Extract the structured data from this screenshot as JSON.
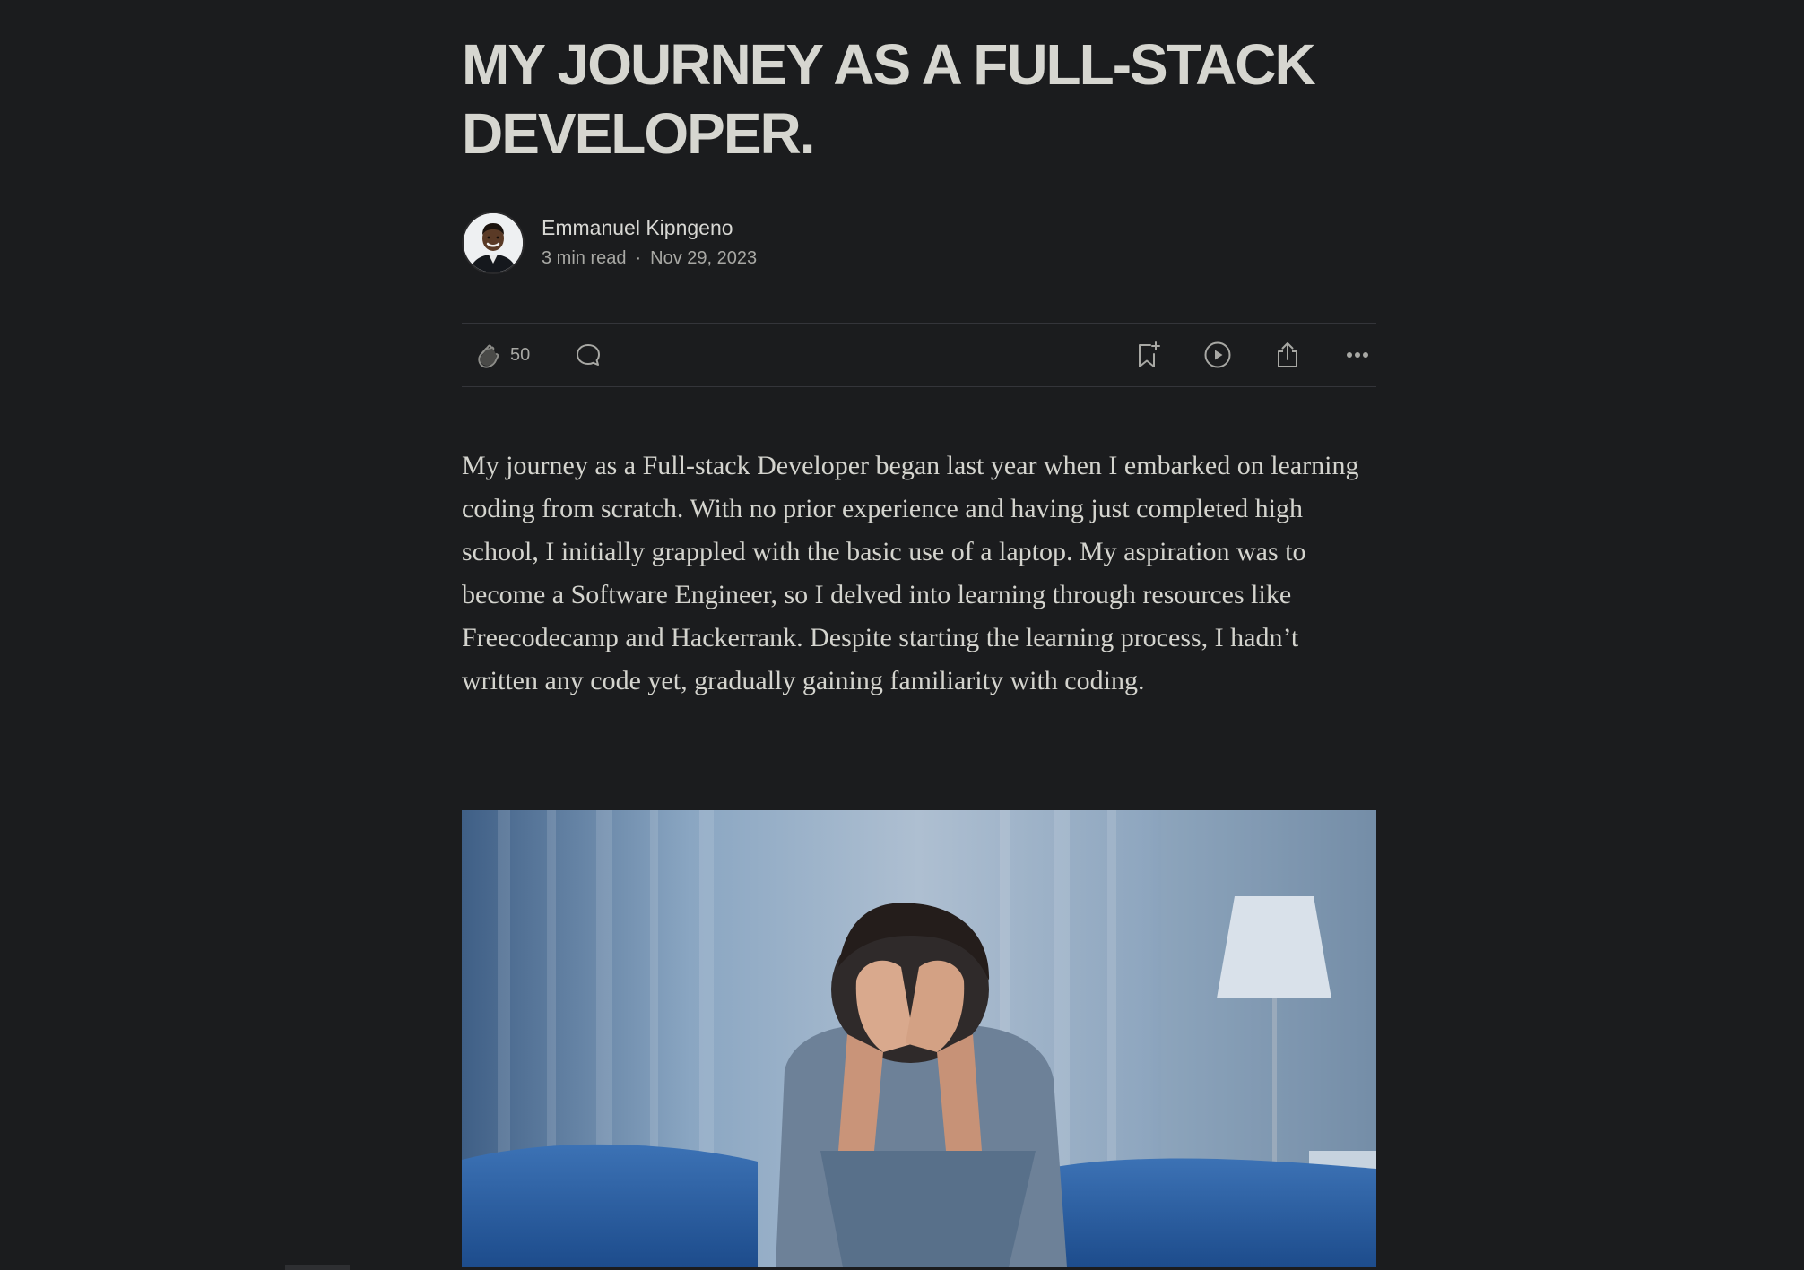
{
  "article": {
    "title": "MY JOURNEY AS A FULL-STACK DEVELOPER.",
    "author": {
      "name": "Emmanuel Kipngeno",
      "read_time": "3 min read",
      "separator": "·",
      "date": "Nov 29, 2023"
    },
    "actions": {
      "clap_count": "50",
      "icons": [
        "clap-icon",
        "comment-icon",
        "bookmark-add-icon",
        "play-icon",
        "share-icon",
        "more-icon"
      ]
    },
    "body": "My journey as a Full-stack Developer began last year when I embarked on learning coding from scratch. With no prior experience and having just completed high school, I initially grappled with the basic use of a laptop. My aspiration was to become a Software Engineer, so I delved into learning through resources like Freecodecamp and Hackerrank. Despite starting the learning process, I hadn’t written any code yet, gradually gaining familiarity with coding."
  },
  "colors": {
    "background": "#1b1c1e",
    "text": "#d4d4ce",
    "muted": "#a8a8a4",
    "divider": "#34353a"
  }
}
